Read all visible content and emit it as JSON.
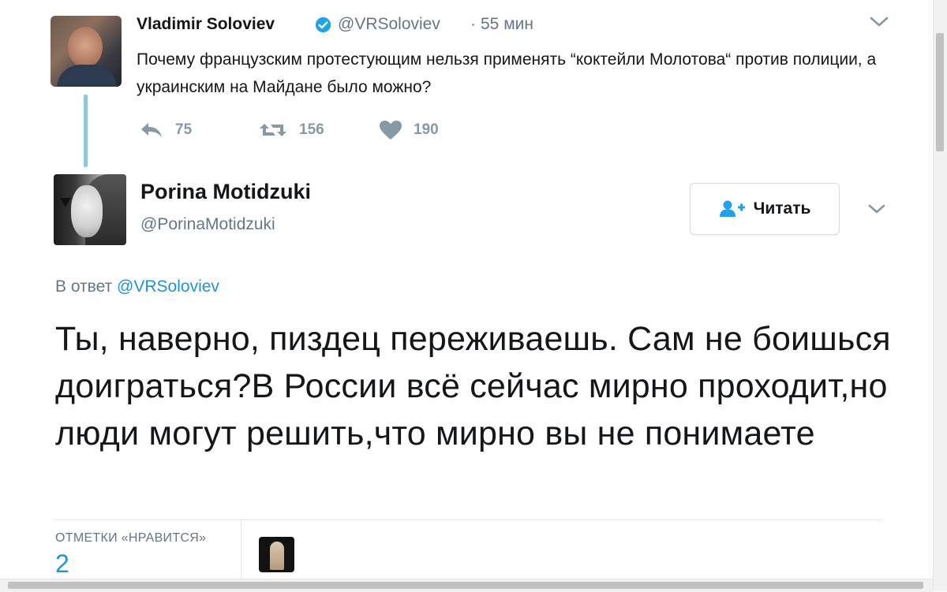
{
  "parent_tweet": {
    "author_name": "Vladimir Soloviev",
    "handle": "@VRSoloviev",
    "separator": "·",
    "time": "55 мин",
    "text": "Почему французским протестующим нельзя применять “коктейли Молотова“ против полиции, а украинским на Майдане было можно?",
    "replies": "75",
    "retweets": "156",
    "likes": "190",
    "verified_icon": "verified-badge-icon",
    "colors": {
      "action_gray": "#8899a6",
      "thread_line": "#8cc5e3",
      "verified": "#1da1f2"
    }
  },
  "reply_tweet": {
    "author_name": "Porina Motidzuki",
    "handle": "@PorinaMotidzuki",
    "follow_label": "Читать",
    "reply_to_prefix": "В ответ",
    "reply_to_mention": "@VRSoloviev",
    "text": "Ты, наверно, пиздец переживаешь. Сам не боишься доиграться?В России всё сейчас мирно проходит,но люди могут решить,что мирно вы не понимаете",
    "likes_label": "ОТМЕТКИ «НРАВИТСЯ»",
    "likes_count": "2",
    "colors": {
      "link": "#1b95e0",
      "secondary": "#657786"
    }
  }
}
